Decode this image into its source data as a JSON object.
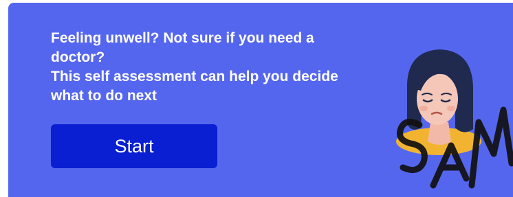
{
  "card": {
    "heading": "Feeling unwell? Not sure if you need a doctor?",
    "subheading": "This self assessment can help you decide what to do next"
  },
  "start_button": {
    "label": "Start"
  },
  "watermark": {
    "text": "SAM"
  },
  "colors": {
    "card_background": "#5566ee",
    "button_background": "#0a1fd1",
    "text": "#ffffff",
    "skin": "#f4c7b8",
    "hair": "#1f2a4e",
    "collar": "#f2b430",
    "watermark": "#111111"
  },
  "icons": {
    "illustration": "unwell-woman-illustration"
  }
}
